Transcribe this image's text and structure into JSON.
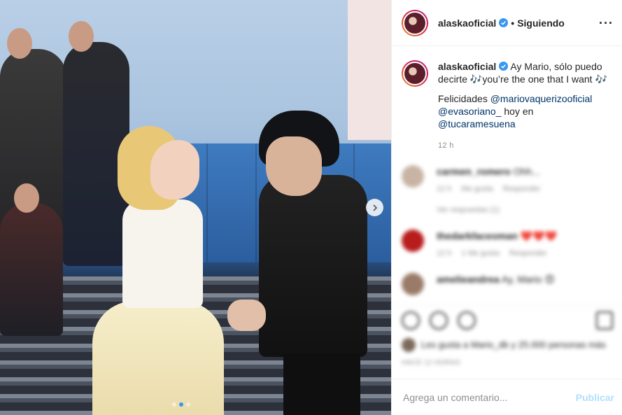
{
  "post": {
    "username": "alaskaoficial",
    "following_label": "Siguiendo",
    "separator": "•",
    "more_icon": "more-horizontal-icon",
    "caption": {
      "username": "alaskaoficial",
      "line1": "Ay Mario, sólo puedo decirte 🎶you’re the one that I want 🎶",
      "line2_prefix": "Felicidades ",
      "mention1": "@mariovaquerizooficial",
      "mention2": "@evasoriano_",
      "line2_mid": " hoy en ",
      "mention3": "@tucaramesuena"
    },
    "time_ago": "12 h"
  },
  "comments": [
    {
      "username": "carmen_romero",
      "text": "Ohh...",
      "meta1": "12 h",
      "meta2": "Me gusta",
      "meta3": "Responder",
      "replies": "Ver respuestas (1)",
      "avatar_color": "#c8b4a4"
    },
    {
      "username": "thedarkfaceoman",
      "text": "❤️❤️❤️",
      "meta1": "12 h",
      "meta2": "1 Me gusta",
      "meta3": "Responder",
      "avatar_color": "#b81c1c"
    },
    {
      "username": "amelieandrea",
      "text": "Ay, Mario 😍",
      "avatar_color": "#9a7a68"
    }
  ],
  "likes_text": "Les gusta a Mario_db y 25.000 personas más",
  "date_text": "HACE 12 HORAS",
  "add_comment": {
    "placeholder": "Agrega un comentario...",
    "publish_label": "Publicar"
  },
  "colors": {
    "accent": "#3897f0",
    "mention": "#003569",
    "muted": "#8e8e8e",
    "publish_disabled": "#b2dffc"
  },
  "carousel": {
    "next_icon": "chevron-right-icon",
    "slides": 3,
    "active_slide": 2
  }
}
